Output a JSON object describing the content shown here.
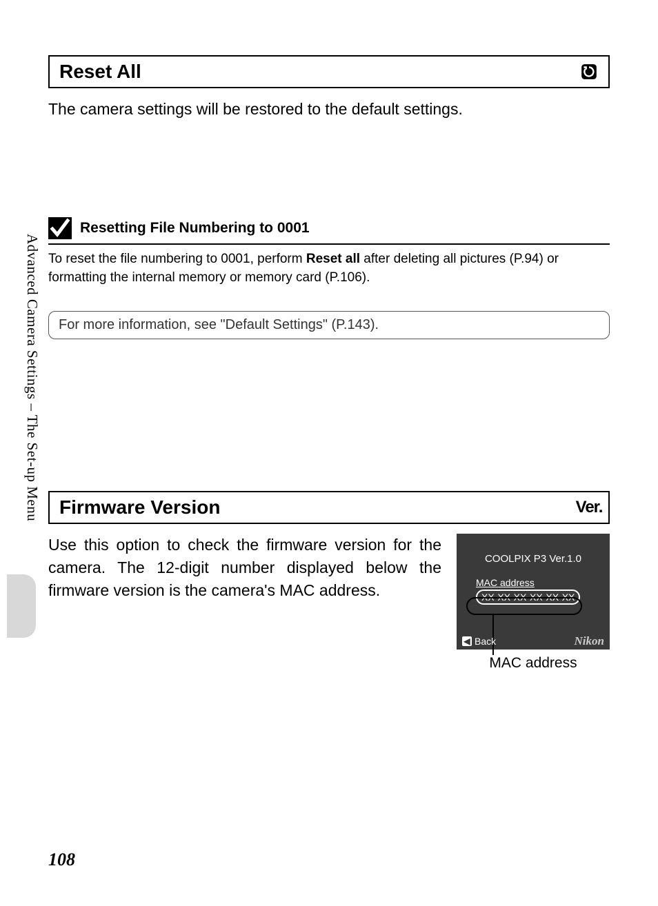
{
  "sidebar": {
    "label": "Advanced Camera Settings – The Set-up Menu"
  },
  "section1": {
    "title": "Reset All",
    "icon_name": "reset-icon",
    "body": "The camera settings will be restored to the default settings."
  },
  "note": {
    "title": "Resetting File Numbering to 0001",
    "body_pre": "To reset the file numbering to 0001, perform ",
    "body_bold": "Reset all",
    "body_post": " after deleting all pictures (P.94) or formatting the internal memory or memory card (P.106)."
  },
  "info_box": {
    "text": "For more information, see \"Default Settings\" (P.143)."
  },
  "section2": {
    "title": "Firmware Version",
    "icon_label": "Ver.",
    "body": "Use this option to check the firmware version for the camera. The 12-digit number displayed below the firmware version is the camera's MAC address."
  },
  "screen": {
    "title": "COOLPIX P3 Ver.1.0",
    "mac_label": "MAC address",
    "mac_value": "XX-XX-XX-XX-XX-XX",
    "back_label": "Back",
    "brand": "Nikon"
  },
  "caption": "MAC address",
  "page_number": "108"
}
